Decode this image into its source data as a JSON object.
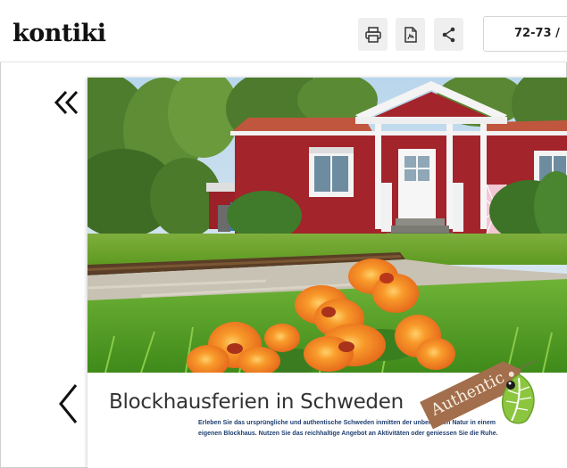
{
  "app": {
    "logo_text": "kontiki"
  },
  "toolbar": {
    "buttons": [
      {
        "icon": "print-icon"
      },
      {
        "icon": "pdf-icon"
      },
      {
        "icon": "share-icon"
      }
    ],
    "page_indicator": "72-73 /"
  },
  "navigation": {
    "back_double": "«",
    "back_single": "‹"
  },
  "article": {
    "headline": "Blockhausferien in Schweden",
    "description_line1": "Erleben Sie das ursprüngliche und authentische Schweden inmitten der unberührten Natur in einem",
    "description_line2": "eigenen Blockhaus. Nutzen Sie das reichhaltige Angebot an Aktivitäten oder geniessen Sie die Ruhe.",
    "badge": "Authentic"
  },
  "colors": {
    "house_red": "#a3242b",
    "flower_orange": "#f28a1c",
    "headline_gray": "#333333",
    "desc_blue": "#1f3f70",
    "tag_brown": "#a26e4c"
  }
}
